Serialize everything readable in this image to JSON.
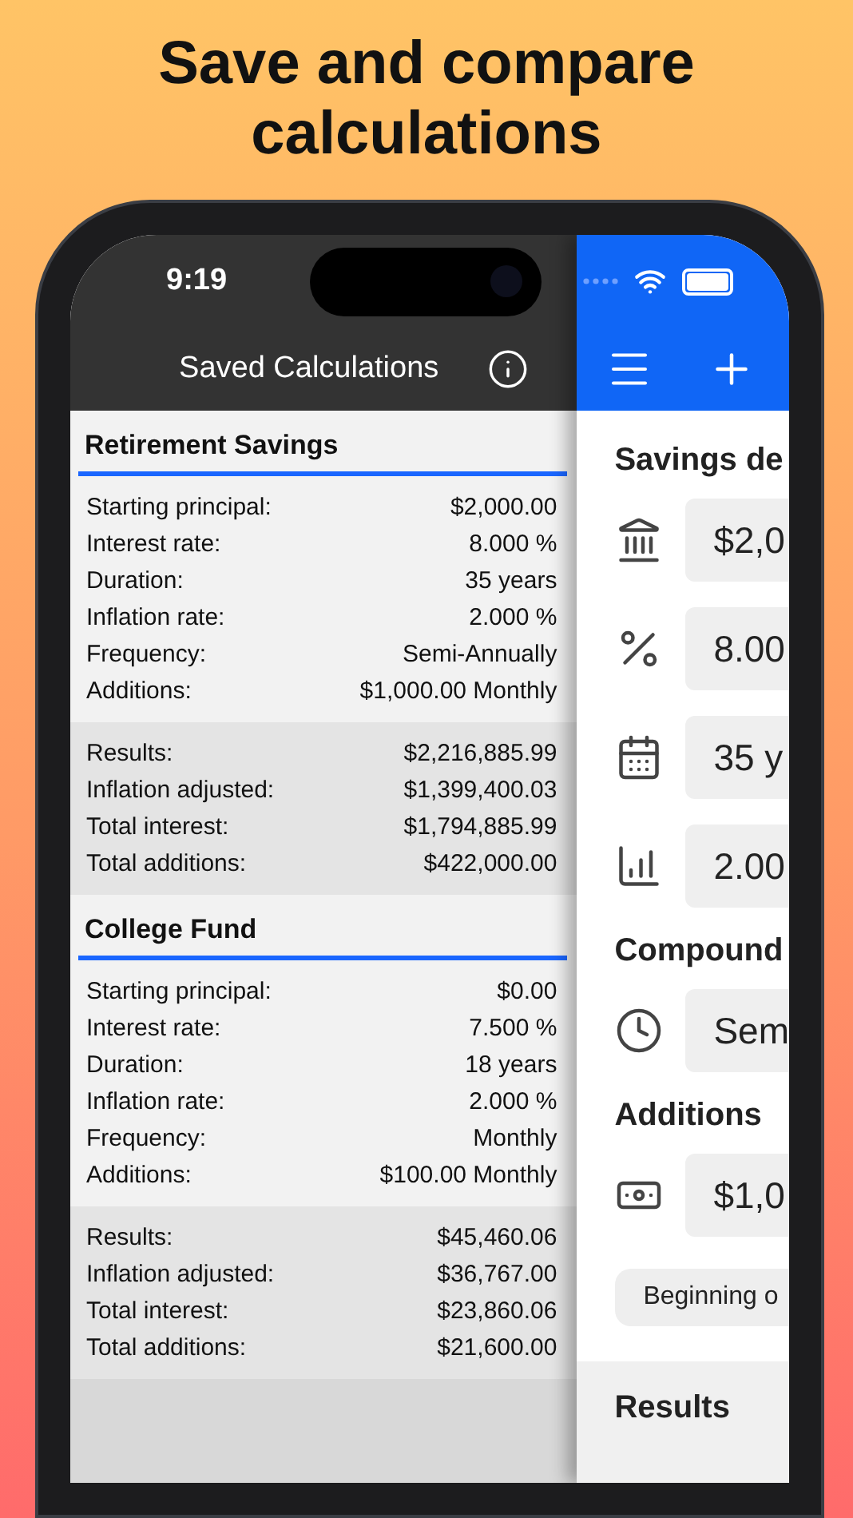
{
  "headline": "Save and compare calculations",
  "status_bar": {
    "time": "9:19"
  },
  "saved_list": {
    "title": "Saved Calculations",
    "calculations": [
      {
        "title": "Retirement Savings",
        "inputs": [
          {
            "label": "Starting principal:",
            "value": "$2,000.00"
          },
          {
            "label": "Interest rate:",
            "value": "8.000 %"
          },
          {
            "label": "Duration:",
            "value": "35 years"
          },
          {
            "label": "Inflation rate:",
            "value": "2.000 %"
          },
          {
            "label": "Frequency:",
            "value": "Semi-Annually"
          },
          {
            "label": "Additions:",
            "value": "$1,000.00 Monthly"
          }
        ],
        "results": [
          {
            "label": "Results:",
            "value": "$2,216,885.99"
          },
          {
            "label": "Inflation adjusted:",
            "value": "$1,399,400.03"
          },
          {
            "label": "Total interest:",
            "value": "$1,794,885.99"
          },
          {
            "label": "Total additions:",
            "value": "$422,000.00"
          }
        ]
      },
      {
        "title": "College Fund",
        "inputs": [
          {
            "label": "Starting principal:",
            "value": "$0.00"
          },
          {
            "label": "Interest rate:",
            "value": "7.500 %"
          },
          {
            "label": "Duration:",
            "value": "18 years"
          },
          {
            "label": "Inflation rate:",
            "value": "2.000 %"
          },
          {
            "label": "Frequency:",
            "value": "Monthly"
          },
          {
            "label": "Additions:",
            "value": "$100.00 Monthly"
          }
        ],
        "results": [
          {
            "label": "Results:",
            "value": "$45,460.06"
          },
          {
            "label": "Inflation adjusted:",
            "value": "$36,767.00"
          },
          {
            "label": "Total interest:",
            "value": "$23,860.06"
          },
          {
            "label": "Total additions:",
            "value": "$21,600.00"
          }
        ]
      }
    ]
  },
  "detail": {
    "sections": [
      {
        "heading": "Savings de",
        "fields": [
          {
            "value": "$2,0"
          },
          {
            "value": "8.00"
          },
          {
            "value": "35 y"
          },
          {
            "value": "2.00"
          }
        ]
      },
      {
        "heading": "Compound",
        "fields": [
          {
            "value": "Sem"
          }
        ]
      },
      {
        "heading": "Additions",
        "fields": [
          {
            "value": "$1,0"
          }
        ],
        "option": "Beginning o"
      }
    ],
    "results_heading": "Results"
  }
}
